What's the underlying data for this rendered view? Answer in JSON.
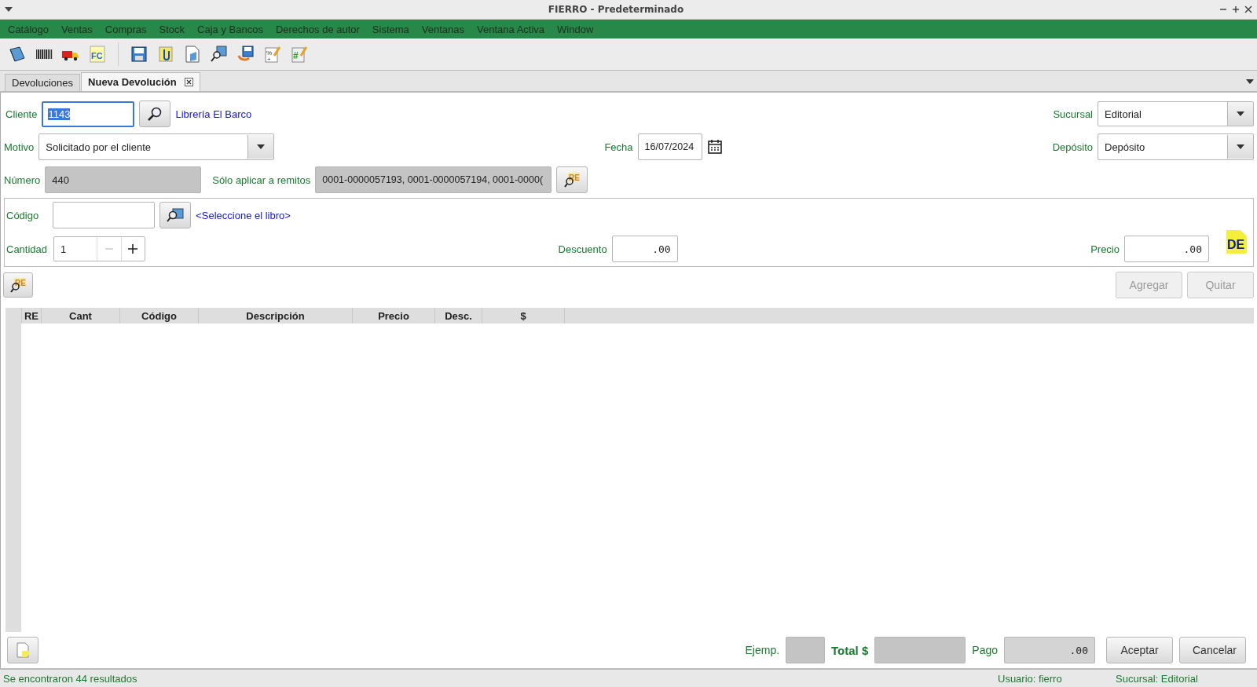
{
  "window": {
    "title": "FIERRO - Predeterminado"
  },
  "menu": [
    "Catálogo",
    "Ventas",
    "Compras",
    "Stock",
    "Caja y Bancos",
    "Derechos de autor",
    "Sistema",
    "Ventanas",
    "Ventana Activa",
    "Window"
  ],
  "tabs": [
    {
      "label": "Devoluciones",
      "selected": false,
      "closable": false
    },
    {
      "label": "Nueva Devolución",
      "selected": true,
      "closable": true
    }
  ],
  "form": {
    "cliente": {
      "label": "Cliente",
      "value": "1143",
      "focused": true,
      "name": "Librería El Barco"
    },
    "sucursal": {
      "label": "Sucursal",
      "value": "Editorial"
    },
    "motivo": {
      "label": "Motivo",
      "value": "Solicitado por el cliente"
    },
    "fecha": {
      "label": "Fecha",
      "value": "16/07/2024"
    },
    "deposito": {
      "label": "Depósito",
      "value": "Depósito"
    },
    "numero": {
      "label": "Número",
      "value": "440",
      "disabled": true
    },
    "remitos": {
      "label": "Sólo aplicar a remitos",
      "value": "0001-0000057193, 0001-0000057194, 0001-0000(",
      "disabled": true
    }
  },
  "toolbar": [
    {
      "kind": "book"
    },
    {
      "kind": "barcode"
    },
    {
      "kind": "truck"
    },
    {
      "kind": "fc",
      "text": "FC"
    },
    {
      "kind": "save"
    },
    {
      "kind": "attach"
    },
    {
      "kind": "document"
    },
    {
      "kind": "search-book"
    },
    {
      "kind": "save-return"
    },
    {
      "kind": "percent",
      "text": "%",
      "text2": "+"
    },
    {
      "kind": "hash",
      "text": "#"
    }
  ],
  "item": {
    "codigo": {
      "label": "Código"
    },
    "hint": "<Seleccione el libro>",
    "badge": "DE",
    "cantidad": {
      "label": "Cantidad",
      "value": "1"
    },
    "descuento": {
      "label": "Descuento",
      "value": ".00"
    },
    "precio": {
      "label": "Precio",
      "value": ".00"
    }
  },
  "re_button_text": "RE",
  "re_button_text_2": "RE",
  "actions": [
    {
      "label": "Agregar",
      "disabled": true
    },
    {
      "label": "Quitar",
      "disabled": true
    }
  ],
  "table": {
    "columns": [
      "RE",
      "Cant",
      "Código",
      "Descripción",
      "Precio",
      "Desc.",
      "$"
    ]
  },
  "footer": {
    "ejemp": {
      "label": "Ejemp."
    },
    "total": {
      "label": "Total $"
    },
    "pago": {
      "label": "Pago",
      "value": ".00"
    },
    "buttons": [
      {
        "label": "Aceptar",
        "disabled": false
      },
      {
        "label": "Cancelar",
        "disabled": false
      }
    ]
  },
  "status_bar": {
    "message": "Se encontraron 44 resultados",
    "usuario": "Usuario: fierro",
    "sucursal": "Sucursal: Editorial"
  }
}
